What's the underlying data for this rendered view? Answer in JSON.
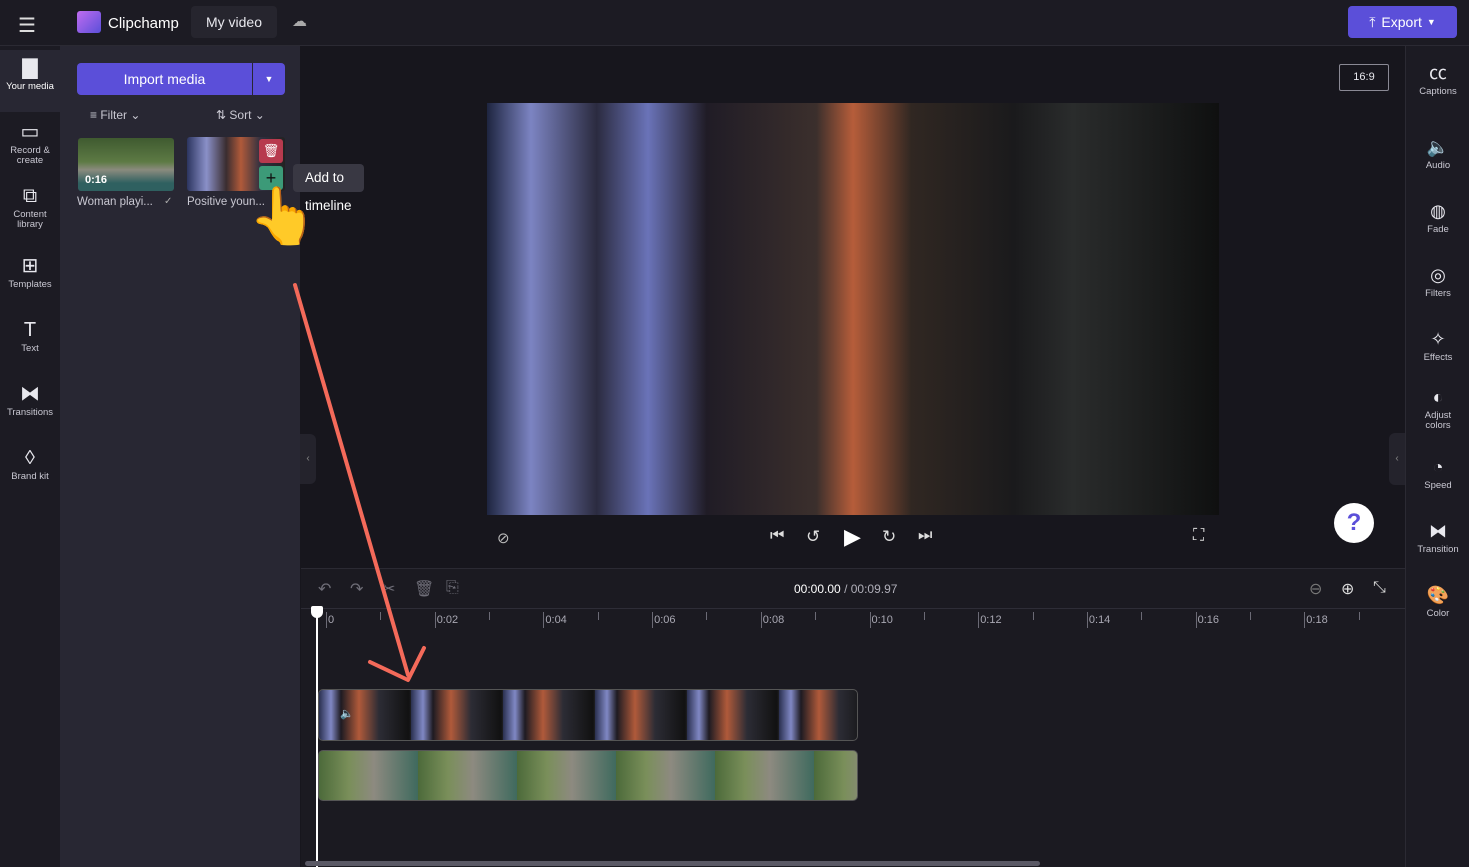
{
  "app": {
    "name": "Clipchamp",
    "project_title": "My video",
    "export_label": "Export",
    "accent": "#5b4fd9"
  },
  "nav": [
    {
      "label": "Your media",
      "icon": "folder-icon"
    },
    {
      "label": "Record & create",
      "icon": "camera-icon"
    },
    {
      "label": "Content library",
      "icon": "library-icon"
    },
    {
      "label": "Templates",
      "icon": "templates-icon"
    },
    {
      "label": "Text",
      "icon": "text-icon"
    },
    {
      "label": "Transitions",
      "icon": "transitions-icon"
    },
    {
      "label": "Brand kit",
      "icon": "brand-icon"
    }
  ],
  "media": {
    "import_label": "Import media",
    "filter_label": "Filter",
    "sort_label": "Sort",
    "items": [
      {
        "title": "Woman playi...",
        "duration": "0:16"
      },
      {
        "title": "Positive youn..."
      }
    ],
    "tooltip": "Add to timeline"
  },
  "preview": {
    "aspect": "16:9"
  },
  "right": [
    {
      "label": "Captions",
      "icon": "captions-icon"
    },
    {
      "label": "Audio",
      "icon": "audio-icon"
    },
    {
      "label": "Fade",
      "icon": "fade-icon"
    },
    {
      "label": "Filters",
      "icon": "filters-icon"
    },
    {
      "label": "Effects",
      "icon": "effects-icon"
    },
    {
      "label": "Adjust colors",
      "icon": "adjust-icon"
    },
    {
      "label": "Speed",
      "icon": "speed-icon"
    },
    {
      "label": "Transition",
      "icon": "transition-icon"
    },
    {
      "label": "Color",
      "icon": "palette-icon"
    }
  ],
  "timeline": {
    "current": "00:00.00",
    "total": "/ 00:09.97",
    "ticks": [
      "0",
      "0:02",
      "0:04",
      "0:06",
      "0:08",
      "0:10",
      "0:12",
      "0:14",
      "0:16",
      "0:18"
    ]
  },
  "help": "?"
}
